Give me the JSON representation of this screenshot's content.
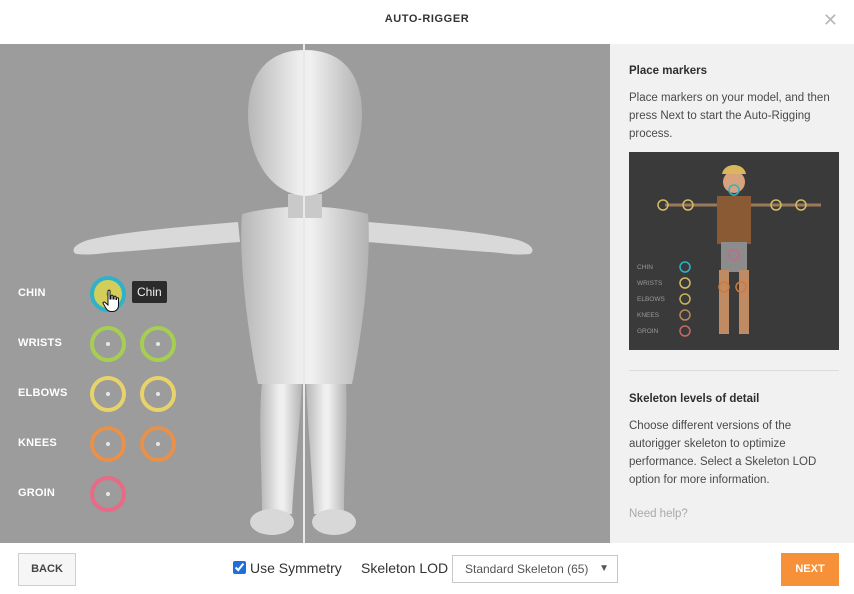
{
  "dialog": {
    "title": "AUTO-RIGGER",
    "close_icon": "close-icon"
  },
  "markers": [
    {
      "label": "CHIN",
      "tooltip": "Chin",
      "colors": [
        "#2db3c9"
      ]
    },
    {
      "label": "WRISTS",
      "colors": [
        "#a6cf52",
        "#a6cf52"
      ]
    },
    {
      "label": "ELBOWS",
      "colors": [
        "#e8d36a",
        "#e8d36a"
      ]
    },
    {
      "label": "KNEES",
      "colors": [
        "#e7914a",
        "#e7914a"
      ]
    },
    {
      "label": "GROIN",
      "colors": [
        "#e86a86"
      ]
    }
  ],
  "side": {
    "place_title": "Place markers",
    "place_text": "Place markers on your model, and then press Next to start the Auto-Rigging process.",
    "preview_legend": [
      "CHIN",
      "WRISTS",
      "ELBOWS",
      "KNEES",
      "GROIN"
    ],
    "lod_title": "Skeleton levels of detail",
    "lod_text": "Choose different versions of the autorigger skeleton to optimize performance. Select a Skeleton LOD option for more information.",
    "help": "Need help?"
  },
  "footer": {
    "back": "BACK",
    "symmetry_label": "Use Symmetry",
    "symmetry_checked": true,
    "lod_label": "Skeleton LOD",
    "lod_value": "Standard Skeleton (65)",
    "next": "NEXT"
  },
  "colors": {
    "accent": "#f6913a",
    "viewport_bg": "#9b9c9b",
    "chin_marker": "#2db3c9"
  }
}
